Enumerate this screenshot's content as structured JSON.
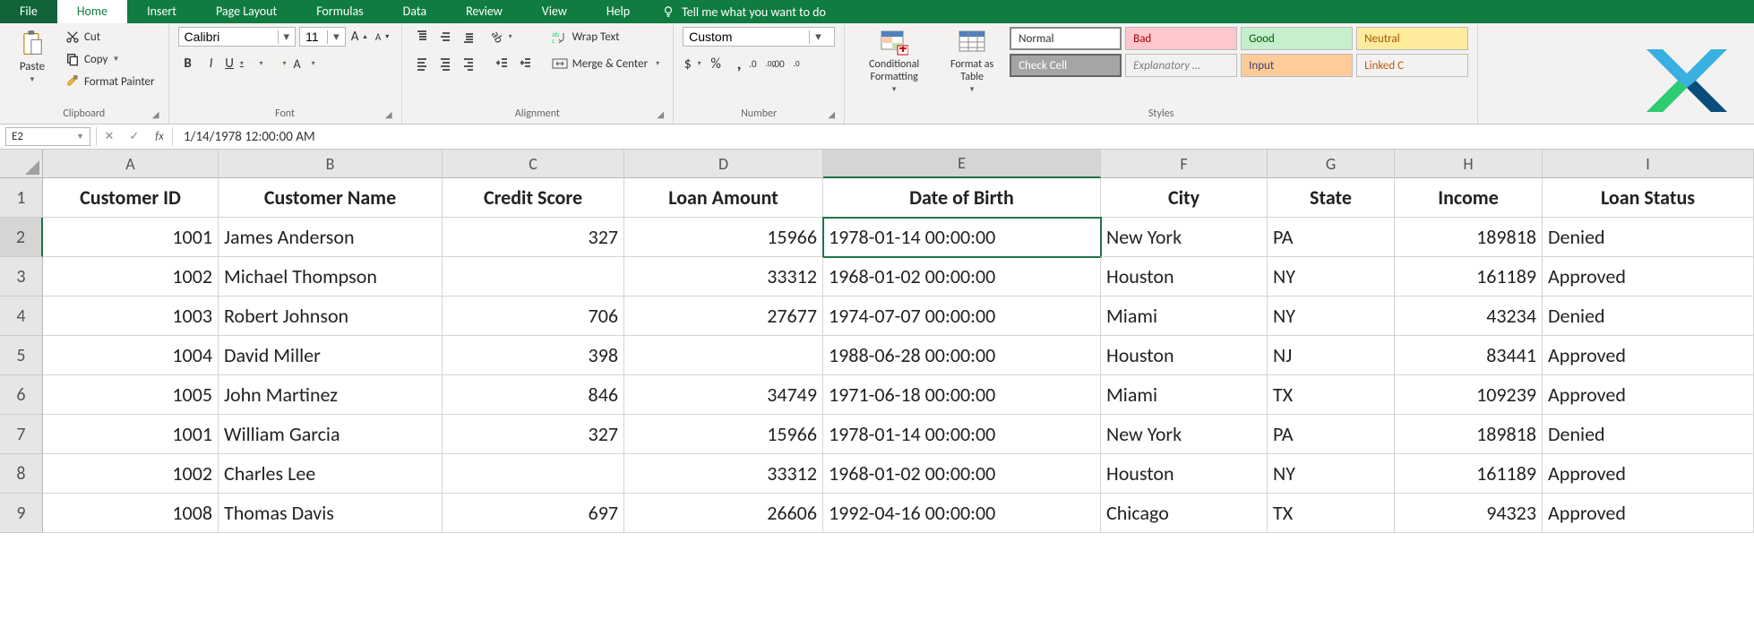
{
  "tabs": {
    "file": "File",
    "home": "Home",
    "insert": "Insert",
    "page_layout": "Page Layout",
    "formulas": "Formulas",
    "data": "Data",
    "review": "Review",
    "view": "View",
    "help": "Help",
    "tellme": "Tell me what you want to do"
  },
  "clipboard": {
    "paste": "Paste",
    "cut": "Cut",
    "copy": "Copy",
    "fp": "Format Painter",
    "group": "Clipboard"
  },
  "font": {
    "name": "Calibri",
    "size": "11",
    "group": "Font"
  },
  "alignment": {
    "wrap": "Wrap Text",
    "merge": "Merge & Center",
    "group": "Alignment"
  },
  "number": {
    "format": "Custom",
    "group": "Number"
  },
  "styles": {
    "cond": "Conditional Formatting",
    "table": "Format as Table",
    "normal": "Normal",
    "bad": "Bad",
    "good": "Good",
    "neutral": "Neutral",
    "check": "Check Cell",
    "explain": "Explanatory …",
    "input": "Input",
    "linked": "Linked C",
    "group": "Styles"
  },
  "name_box": "E2",
  "formula": "1/14/1978  12:00:00 AM",
  "columns": [
    "A",
    "B",
    "C",
    "D",
    "E",
    "F",
    "G",
    "H",
    "I"
  ],
  "selected_col_index": 4,
  "selected_row_index": 1,
  "headers": [
    "Customer ID",
    "Customer Name",
    "Credit Score",
    "Loan Amount",
    "Date of Birth",
    "City",
    "State",
    "Income",
    "Loan Status"
  ],
  "rows": [
    {
      "id": "1001",
      "name": "James Anderson",
      "score": "327",
      "loan": "15966",
      "dob": "1978-01-14 00:00:00",
      "city": "New York",
      "state": "PA",
      "income": "189818",
      "status": "Denied"
    },
    {
      "id": "1002",
      "name": "Michael Thompson",
      "score": "",
      "loan": "33312",
      "dob": "1968-01-02 00:00:00",
      "city": "Houston",
      "state": "NY",
      "income": "161189",
      "status": "Approved"
    },
    {
      "id": "1003",
      "name": "Robert Johnson",
      "score": "706",
      "loan": "27677",
      "dob": "1974-07-07 00:00:00",
      "city": "Miami",
      "state": "NY",
      "income": "43234",
      "status": "Denied"
    },
    {
      "id": "1004",
      "name": "David Miller",
      "score": "398",
      "loan": "",
      "dob": "1988-06-28 00:00:00",
      "city": "Houston",
      "state": "NJ",
      "income": "83441",
      "status": "Approved"
    },
    {
      "id": "1005",
      "name": "John Martinez",
      "score": "846",
      "loan": "34749",
      "dob": "1971-06-18 00:00:00",
      "city": "Miami",
      "state": "TX",
      "income": "109239",
      "status": "Approved"
    },
    {
      "id": "1001",
      "name": "William Garcia",
      "score": "327",
      "loan": "15966",
      "dob": "1978-01-14 00:00:00",
      "city": "New York",
      "state": "PA",
      "income": "189818",
      "status": "Denied"
    },
    {
      "id": "1002",
      "name": "Charles Lee",
      "score": "",
      "loan": "33312",
      "dob": "1968-01-02 00:00:00",
      "city": "Houston",
      "state": "NY",
      "income": "161189",
      "status": "Approved"
    },
    {
      "id": "1008",
      "name": "Thomas Davis",
      "score": "697",
      "loan": "26606",
      "dob": "1992-04-16 00:00:00",
      "city": "Chicago",
      "state": "TX",
      "income": "94323",
      "status": "Approved"
    }
  ]
}
